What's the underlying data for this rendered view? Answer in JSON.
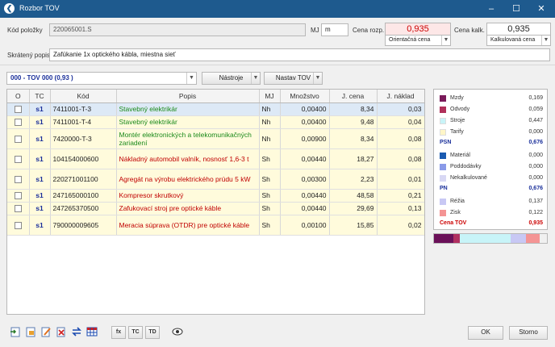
{
  "window": {
    "title": "Rozbor TOV"
  },
  "form": {
    "kod_label": "Kód položky",
    "kod_value": "220065001.S",
    "mj_label": "MJ",
    "mj_value": "m",
    "cena_rozp_label": "Cena rozp.",
    "cena_rozp_value": "0,935",
    "cena_rozp_type": "Orientačná cena",
    "cena_kalk_label": "Cena kalk.",
    "cena_kalk_value": "0,935",
    "cena_kalk_type": "Kalkulovaná cena",
    "popis_label": "Skrátený popis",
    "popis_value": "Zafúkanie 1x optického kábla, miestna sieť"
  },
  "toolbar": {
    "tov_select": "000 - TOV 000 (0,93 )",
    "nastroje": "Nástroje",
    "nastav_tov": "Nastav TOV"
  },
  "grid": {
    "headers": [
      "O",
      "TC",
      "Kód",
      "Popis",
      "MJ",
      "Množstvo",
      "J. cena",
      "J. náklad"
    ],
    "rows": [
      {
        "tc": "s1",
        "kod": "7411001-T-3",
        "popis": "Stavebný elektrikár",
        "popis_color": "#1a8a1a",
        "mj": "Nh",
        "mnozstvo": "0,00400",
        "jcena": "8,34",
        "jnaklad": "0,03"
      },
      {
        "tc": "s1",
        "kod": "7411001-T-4",
        "popis": "Stavebný elektrikár",
        "popis_color": "#1a8a1a",
        "mj": "Nh",
        "mnozstvo": "0,00400",
        "jcena": "9,48",
        "jnaklad": "0,04"
      },
      {
        "tc": "s1",
        "kod": "7420000-T-3",
        "popis": "Montér elektronických a telekomunikačných zariadení",
        "popis_color": "#1a8a1a",
        "mj": "Nh",
        "mnozstvo": "0,00900",
        "jcena": "8,34",
        "jnaklad": "0,08"
      },
      {
        "tc": "s1",
        "kod": "104154000600",
        "popis": "Nákladný automobil valník, nosnosť 1,6-3 t",
        "popis_color": "#c00000",
        "mj": "Sh",
        "mnozstvo": "0,00440",
        "jcena": "18,27",
        "jnaklad": "0,08"
      },
      {
        "tc": "s1",
        "kod": "220271001100",
        "popis": "Agregát na výrobu elektrického prúdu 5 kW",
        "popis_color": "#c00000",
        "mj": "Sh",
        "mnozstvo": "0,00300",
        "jcena": "2,23",
        "jnaklad": "0,01"
      },
      {
        "tc": "s1",
        "kod": "247165000100",
        "popis": "Kompresor skrutkový",
        "popis_color": "#c00000",
        "mj": "Sh",
        "mnozstvo": "0,00440",
        "jcena": "48,58",
        "jnaklad": "0,21"
      },
      {
        "tc": "s1",
        "kod": "247265370500",
        "popis": "Zafukovací stroj pre optické káble",
        "popis_color": "#c00000",
        "mj": "Sh",
        "mnozstvo": "0,00440",
        "jcena": "29,69",
        "jnaklad": "0,13"
      },
      {
        "tc": "s1",
        "kod": "790000009605",
        "popis": "Meracia súprava (OTDR) pre optické káble",
        "popis_color": "#c00000",
        "mj": "Sh",
        "mnozstvo": "0,00100",
        "jcena": "15,85",
        "jnaklad": "0,02"
      }
    ]
  },
  "summary": {
    "items": [
      {
        "name": "Mzdy",
        "value": "0,169",
        "color": "#7a1a5a"
      },
      {
        "name": "Odvody",
        "value": "0,059",
        "color": "#b0305a"
      },
      {
        "name": "Stroje",
        "value": "0,447",
        "color": "#c8f4f8"
      },
      {
        "name": "Tarify",
        "value": "0,000",
        "color": "#fff6c8"
      },
      {
        "name": "PSN",
        "value": "0,676",
        "sum": true
      },
      {
        "name": "Materiál",
        "value": "0,000",
        "color": "#1a5ab0"
      },
      {
        "name": "Poddodávky",
        "value": "0,000",
        "color": "#8a9ae8"
      },
      {
        "name": "Nekalkulované",
        "value": "0,000",
        "color": "#d8d8f4"
      },
      {
        "name": "PN",
        "value": "0,676",
        "sum": true
      },
      {
        "name": "Réžia",
        "value": "0,137",
        "color": "#c8c8f4"
      },
      {
        "name": "Zisk",
        "value": "0,122",
        "color": "#f49494"
      },
      {
        "name": "Cena TOV",
        "value": "0,935",
        "total": true
      }
    ],
    "bar": [
      {
        "value": 0.169,
        "color": "#6a1058"
      },
      {
        "value": 0.059,
        "color": "#b03060"
      },
      {
        "value": 0.447,
        "color": "#c8f4f8"
      },
      {
        "value": 0.137,
        "color": "#c8c8f4"
      },
      {
        "value": 0.122,
        "color": "#f49494"
      }
    ]
  },
  "footer": {
    "fx": "fx",
    "tc": "TC",
    "td": "TD",
    "ok": "OK",
    "storno": "Storno"
  }
}
